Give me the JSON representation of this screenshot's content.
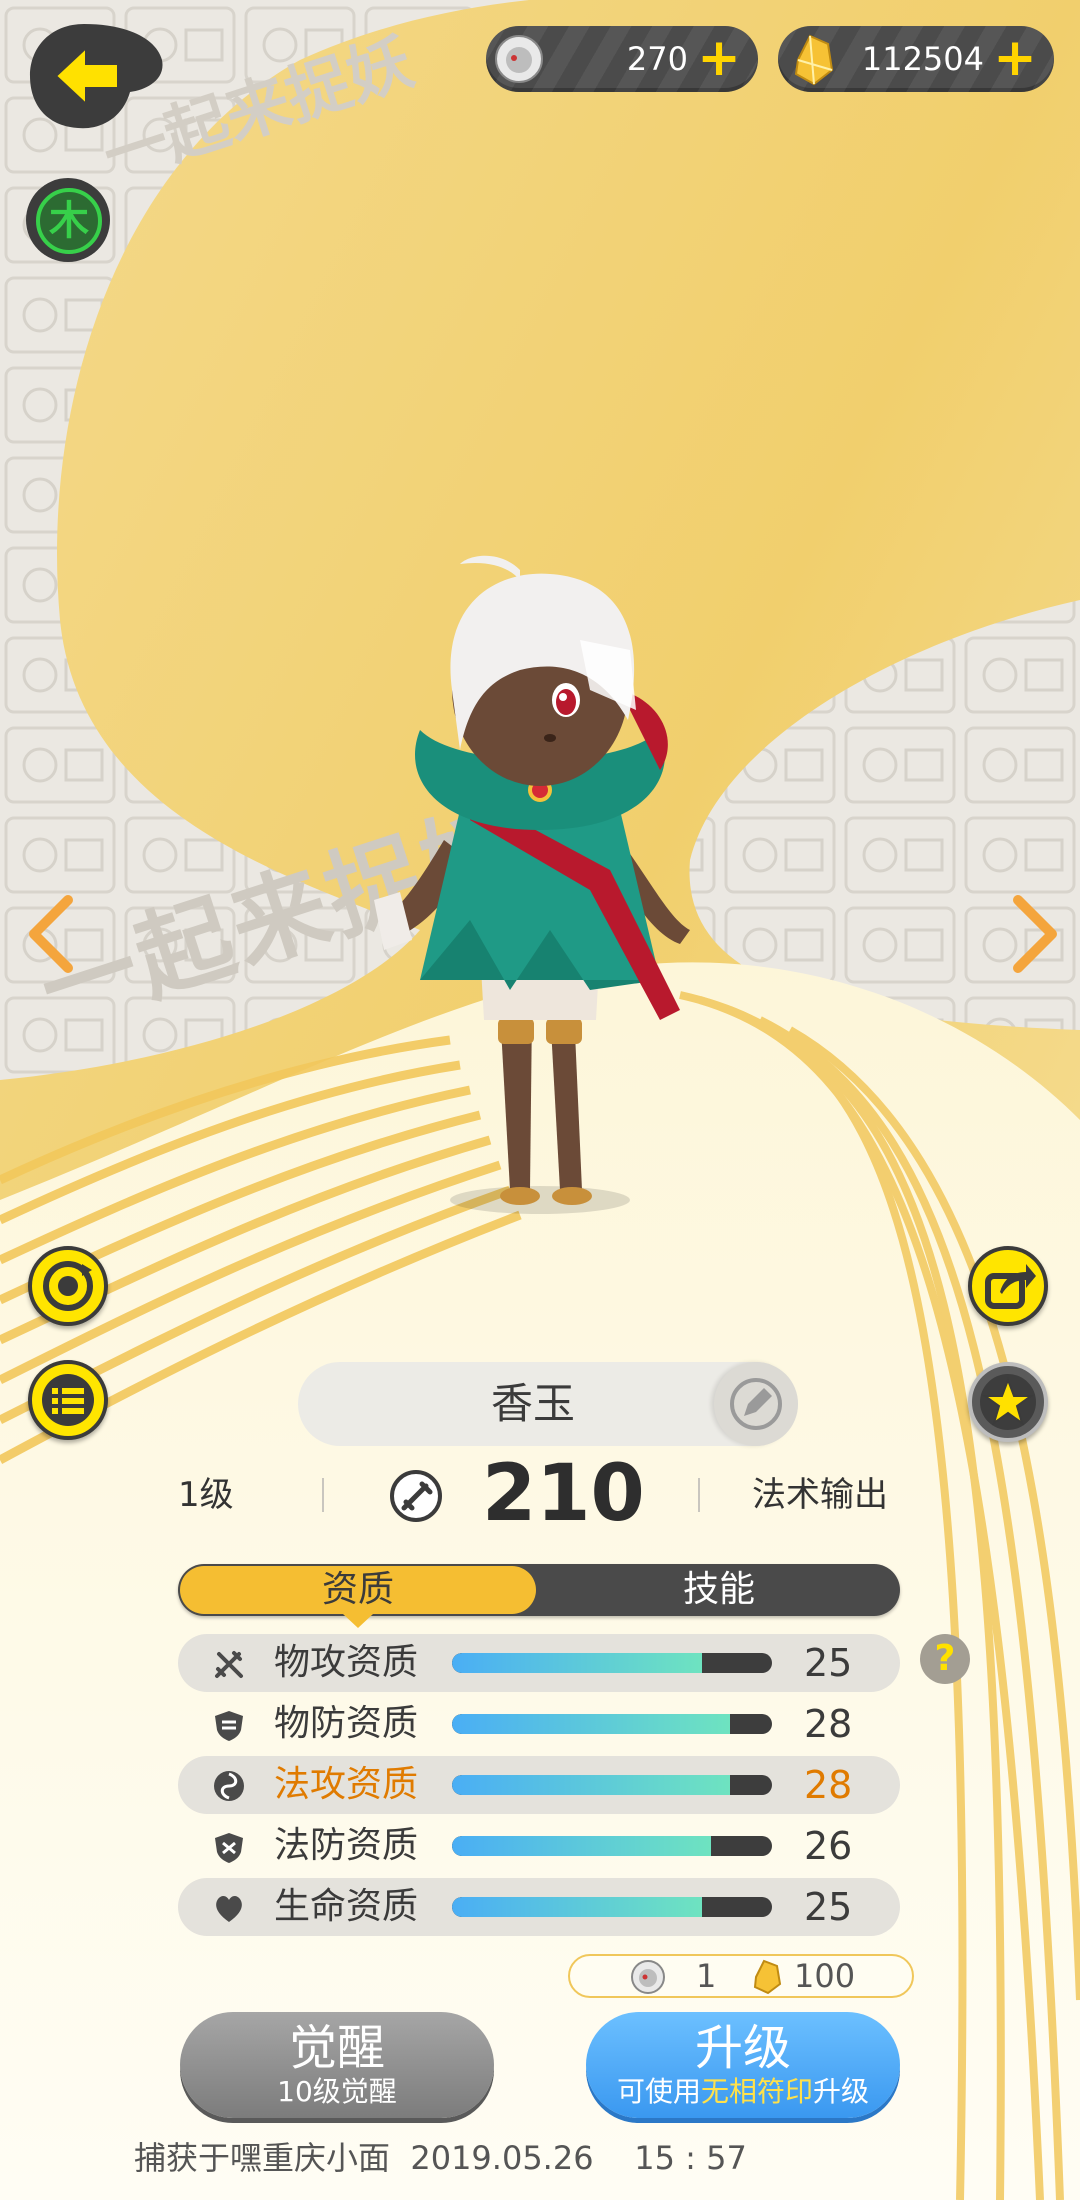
{
  "currency": {
    "coins": "270",
    "crystals": "112504"
  },
  "element_badge": "木",
  "watermark_text": "一起来捉妖",
  "monster": {
    "name": "香玉",
    "level": "1级",
    "power": "210",
    "role": "法术输出"
  },
  "tabs": {
    "active": "资质",
    "inactive": "技能"
  },
  "stats": [
    {
      "label": "物攻资质",
      "value": "25",
      "fill": 0.78,
      "icon": "crossed-swords-icon"
    },
    {
      "label": "物防资质",
      "value": "28",
      "fill": 0.87,
      "icon": "shield-icon"
    },
    {
      "label": "法攻资质",
      "value": "28",
      "fill": 0.87,
      "icon": "swirl-icon",
      "highlight": true
    },
    {
      "label": "法防资质",
      "value": "26",
      "fill": 0.81,
      "icon": "magic-shield-icon"
    },
    {
      "label": "生命资质",
      "value": "25",
      "fill": 0.78,
      "icon": "heart-icon"
    }
  ],
  "cost": {
    "coins": "1",
    "crystals": "100"
  },
  "buttons": {
    "awaken_label": "觉醒",
    "awaken_sub": "10级觉醒",
    "upgrade_label": "升级",
    "upgrade_sub_pre": "可使用",
    "upgrade_sub_hl": "无相符印",
    "upgrade_sub_post": "升级"
  },
  "capture_info": "捕获于嘿重庆小面  2019.05.26    15 : 57",
  "colors": {
    "accent_yellow": "#f5be32",
    "highlight_orange": "#e07b00",
    "button_blue": "#4aa9f7"
  }
}
